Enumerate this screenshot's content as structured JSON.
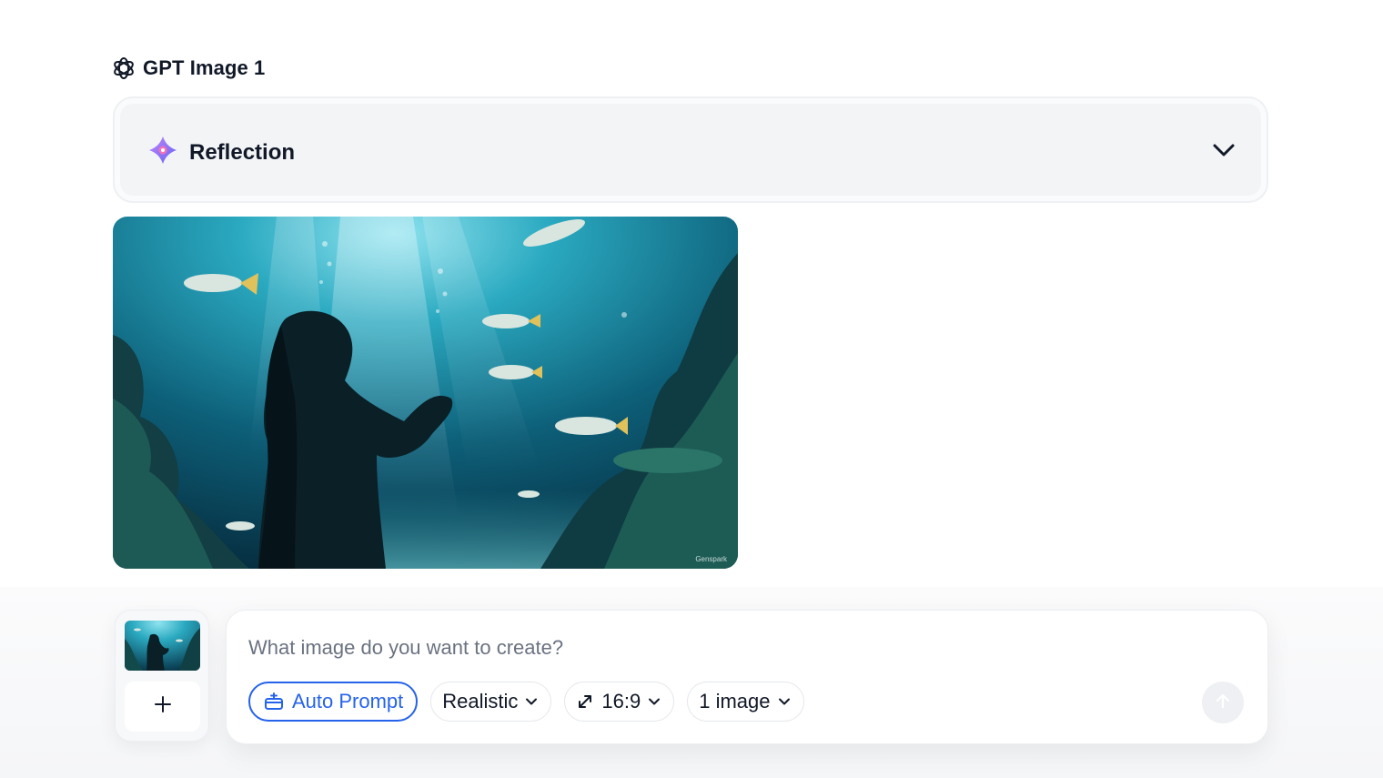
{
  "header": {
    "model_name": "GPT Image 1",
    "model_icon": "openai-logo-icon"
  },
  "reflection": {
    "label": "Reflection",
    "icon": "sparkle-flower-icon",
    "toggle_icon": "chevron-down-icon"
  },
  "generated_image": {
    "watermark": "Genspark"
  },
  "reference_panel": {
    "add_icon": "plus-icon"
  },
  "composer": {
    "placeholder": "What image do you want to create?",
    "value": "",
    "chips": {
      "auto_prompt": "Auto Prompt",
      "style": "Realistic",
      "aspect_ratio": "16:9",
      "count": "1 image"
    },
    "send_icon": "arrow-up-icon"
  },
  "colors": {
    "accent": "#2563eb",
    "text": "#111827",
    "placeholder": "#6b7280",
    "card_bg": "#f3f4f6"
  }
}
